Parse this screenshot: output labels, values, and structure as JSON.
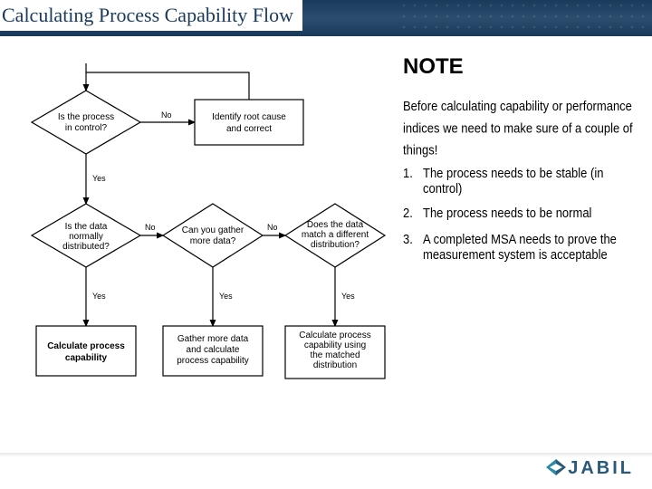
{
  "header": {
    "title": "Calculating Process Capability Flow"
  },
  "flow": {
    "d1": {
      "l1": "Is the process",
      "l2": "in control?"
    },
    "r1": {
      "l1": "Identify root cause",
      "l2": "and correct"
    },
    "d2": {
      "l1": "Is the data",
      "l2": "normally",
      "l3": "distributed?"
    },
    "d3": {
      "l1": "Can you gather",
      "l2": "more data?"
    },
    "d4": {
      "l1": "Does the data",
      "l2": "match a different",
      "l3": "distribution?"
    },
    "b1": {
      "l1": "Calculate process",
      "l2": "capability"
    },
    "b2": {
      "l1": "Gather more data",
      "l2": "and calculate",
      "l3": "process capability"
    },
    "b3": {
      "l1": "Calculate process",
      "l2": "capability using",
      "l3": "the matched",
      "l4": "distribution"
    },
    "labels": {
      "no": "No",
      "yes": "Yes"
    }
  },
  "note": {
    "title": "NOTE",
    "body": "Before calculating capability or performance indices we need to make sure of a couple of things!",
    "items": [
      "The process needs to be stable (in control)",
      "The process needs to be normal",
      "A completed MSA needs to prove the measurement system is acceptable"
    ]
  },
  "logo": {
    "text": "JABIL"
  }
}
